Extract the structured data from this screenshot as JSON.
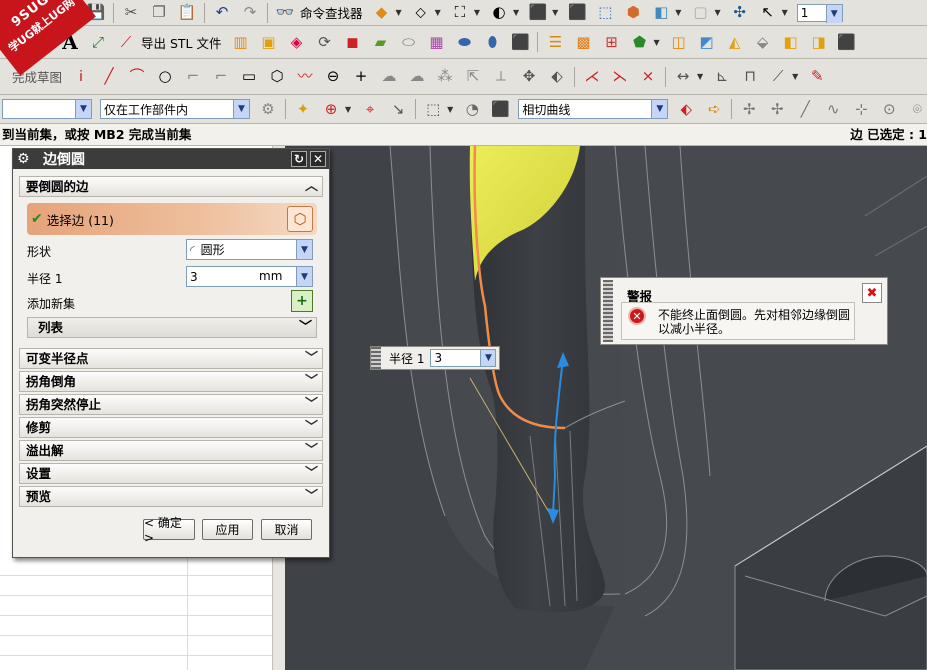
{
  "watermark": {
    "line1": "9SUG",
    "line2": "学UG就上UG网"
  },
  "toolbar1": {
    "command_finder": "命令查找器",
    "layer_value": "1"
  },
  "toolbar2": {
    "export_stl": "导出 STL 文件"
  },
  "toolbar3": {
    "finish_sketch": "完成草图"
  },
  "toolbar4": {
    "selection_filter": "仅在工作部件内",
    "curve_rule": "相切曲线"
  },
  "status": {
    "prompt": "到当前集，或按 MB2 完成当前集",
    "selection": "边 已选定 : 1"
  },
  "dialog": {
    "title": "边倒圆",
    "section_edges": "要倒圆的边",
    "select_edge": "选择边 (11)",
    "shape_label": "形状",
    "shape_value": "圆形",
    "radius_label": "半径 1",
    "radius_value": "3",
    "radius_unit": "mm",
    "add_new_set": "添加新集",
    "list_label": "列表",
    "sections": [
      "可变半径点",
      "拐角倒角",
      "拐角突然停止",
      "修剪",
      "溢出解",
      "设置",
      "预览"
    ],
    "ok": "< 确定 >",
    "apply": "应用",
    "cancel": "取消"
  },
  "radius_popup": {
    "label": "半径 1",
    "value": "3"
  },
  "alert": {
    "title": "警报",
    "message": "不能终止面倒圆。先对相邻边缘倒圆以减小半径。"
  },
  "colors": {
    "viewport_bg": "#4a4d52",
    "highlight_edge": "#f08c46",
    "face_yellow": "#e4e443",
    "dialog_title_bg": "#3c3c3c"
  }
}
